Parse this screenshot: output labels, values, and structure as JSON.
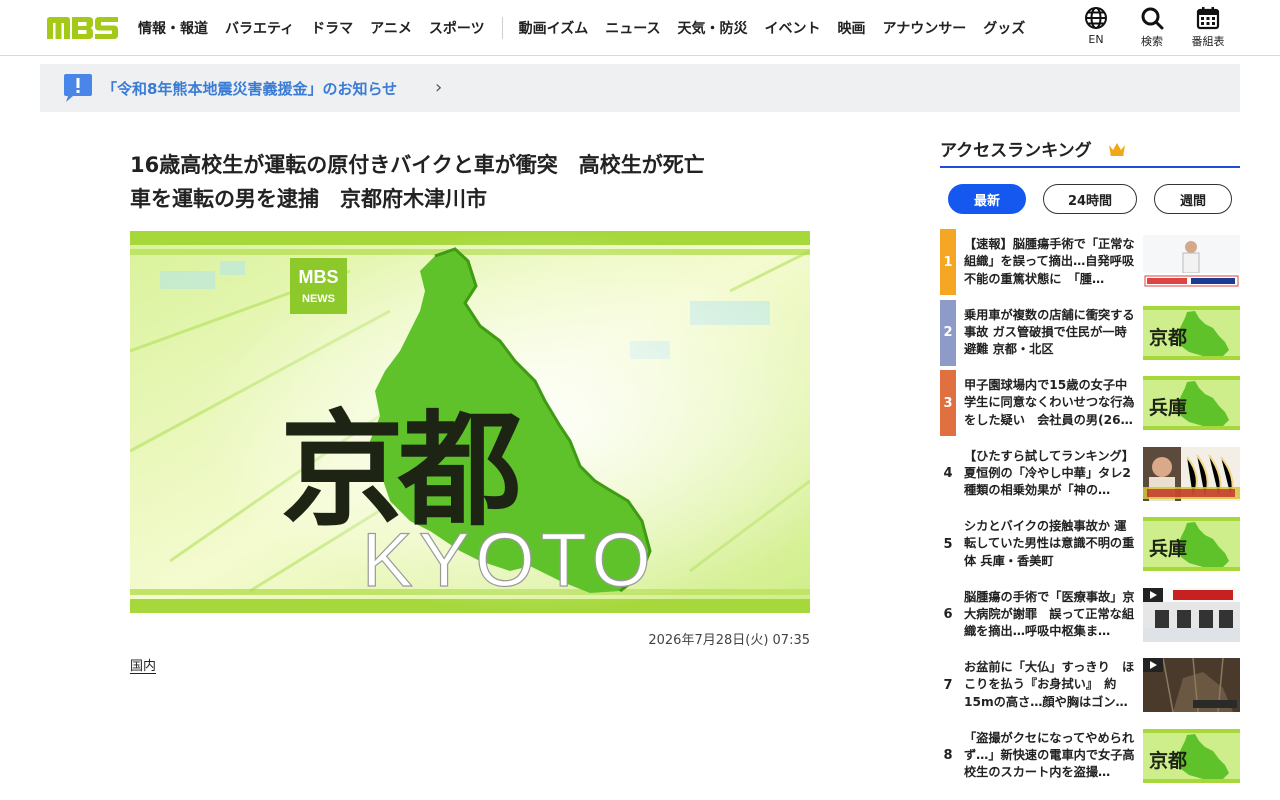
{
  "header": {
    "logo_text": "MBS",
    "nav": [
      "情報・報道",
      "バラエティ",
      "ドラマ",
      "アニメ",
      "スポーツ"
    ],
    "nav2": [
      "動画イズム",
      "ニュース",
      "天気・防災",
      "イベント",
      "映画",
      "アナウンサー",
      "グッズ"
    ],
    "icons": [
      {
        "icon": "globe-icon",
        "label": "EN"
      },
      {
        "icon": "search-icon",
        "label": "検索"
      },
      {
        "icon": "calendar-icon",
        "label": "番組表"
      }
    ]
  },
  "notice": {
    "text": "「令和8年熊本地震災害義援金」のお知らせ",
    "icon": "exclamation-bubble-icon",
    "accent": "#3a7bd5"
  },
  "article": {
    "title_line1": "16歳高校生が運転の原付きバイクと車が衝突　高校生が死亡",
    "title_line2": "車を運転の男を逮捕　京都府木津川市",
    "hero": {
      "logo_top": "MBS",
      "logo_bottom": "NEWS",
      "kanji": "京都",
      "roman": "KYOTO"
    },
    "date": "2026年7月28日(火) 07:35",
    "category": "国内"
  },
  "ranking": {
    "title": "アクセスランキング",
    "tabs": [
      "最新",
      "24時間",
      "週間"
    ],
    "active_tab": "最新",
    "items": [
      {
        "rank": "1",
        "text": "【速報】脳腫瘍手術で「正常な組織」を誤って摘出…自発呼吸不能の重篤状態に　「腫…",
        "thumb": "press",
        "color": "#f5a623"
      },
      {
        "rank": "2",
        "text": "乗用車が複数の店舗に衝突する事故 ガス管破損で住民が一時避難 京都・北区",
        "thumb": "京都",
        "color": "#8e9bc9"
      },
      {
        "rank": "3",
        "text": "甲子園球場内で15歳の女子中学生に同意なくわいせつな行為をした疑い　会社員の男(26…",
        "thumb": "兵庫",
        "color": "#e07040"
      },
      {
        "rank": "4",
        "text": "【ひたすら試してランキング】夏恒例の「冷やし中華」タレ2種類の相乗効果が「神の…",
        "thumb": "noodle",
        "color": ""
      },
      {
        "rank": "5",
        "text": "シカとバイクの接触事故か 運転していた男性は意識不明の重体 兵庫・香美町",
        "thumb": "兵庫",
        "color": ""
      },
      {
        "rank": "6",
        "text": "脳腫瘍の手術で「医療事故」京大病院が謝罪　誤って正常な組織を摘出…呼吸中枢集ま…",
        "thumb": "apology",
        "color": ""
      },
      {
        "rank": "7",
        "text": "お盆前に「大仏」すっきり　ほこりを払う『お身拭い』　約15mの高さ…顔や胸はゴン…",
        "thumb": "buddha",
        "color": ""
      },
      {
        "rank": "8",
        "text": "「盗撮がクセになってやめられず…」新快速の電車内で女子高校生のスカート内を盗撮…",
        "thumb": "京都",
        "color": ""
      }
    ]
  },
  "colors": {
    "logo_green": "#a5c919",
    "active_tab": "#1558f0",
    "rank_underline": "#1b50d6"
  }
}
